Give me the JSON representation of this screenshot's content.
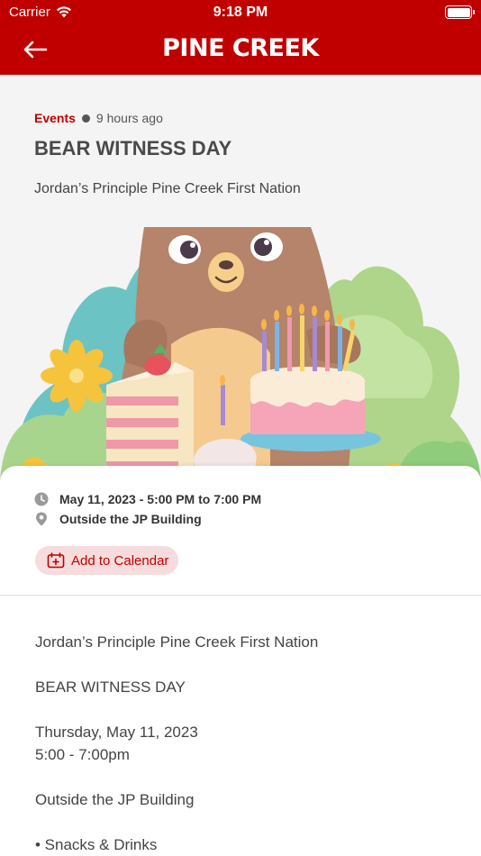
{
  "status_bar": {
    "carrier": "Carrier",
    "time": "9:18 PM"
  },
  "nav": {
    "title": "PINE CREEK",
    "back_icon": "arrow-left-icon"
  },
  "article": {
    "category": "Events",
    "time_ago": "9 hours ago",
    "title": "BEAR WITNESS DAY",
    "subtitle": "Jordan’s Principle Pine Creek First Nation"
  },
  "details": {
    "datetime": "May 11, 2023 - 5:00 PM to 7:00 PM",
    "location": "Outside the JP Building",
    "add_to_calendar": "Add to Calendar"
  },
  "description": {
    "line1": "Jordan’s Principle Pine Creek First Nation",
    "line2": "BEAR WITNESS DAY",
    "line3a": "Thursday, May 11, 2023",
    "line3b": "5:00 - 7:00pm",
    "line4": "Outside the JP Building",
    "line5": "• Snacks & Drinks"
  },
  "colors": {
    "brand": "#c00000",
    "pill_bg": "#f6dcdc"
  }
}
